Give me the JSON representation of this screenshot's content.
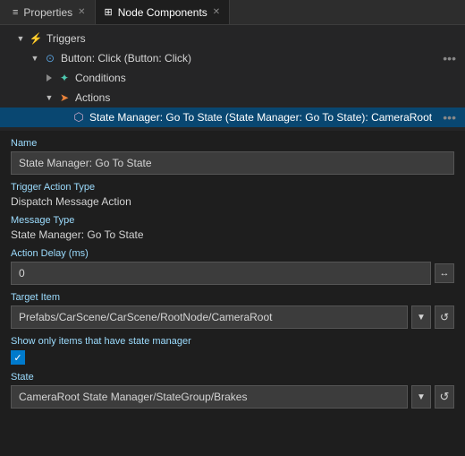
{
  "tabs": [
    {
      "id": "properties",
      "label": "Properties",
      "icon": "≡",
      "active": false
    },
    {
      "id": "node-components",
      "label": "Node Components",
      "icon": "⊞",
      "active": true
    }
  ],
  "tree": {
    "triggers_label": "Triggers",
    "button_label": "Button: Click (Button: Click)",
    "conditions_label": "Conditions",
    "actions_label": "Actions",
    "state_manager_label": "State Manager: Go To State (State Manager: Go To State): CameraRoot"
  },
  "properties": {
    "name_label": "Name",
    "name_value": "State Manager: Go To State",
    "trigger_action_type_label": "Trigger Action Type",
    "trigger_action_type_value": "Dispatch Message Action",
    "message_type_label": "Message Type",
    "message_type_value": "State Manager: Go To State",
    "action_delay_label": "Action Delay (ms)",
    "action_delay_value": "0",
    "target_item_label": "Target Item",
    "target_item_value": "Prefabs/CarScene/CarScene/RootNode/CameraRoot",
    "show_only_label": "Show only items that have state manager",
    "state_label": "State",
    "state_value": "CameraRoot State Manager/StateGroup/Brakes"
  },
  "icons": {
    "expand_arrows": "↔",
    "dropdown_arrow": "▼",
    "refresh": "↺",
    "checkmark": "✓",
    "menu_dots": "•••",
    "state_icon": "⊡"
  }
}
